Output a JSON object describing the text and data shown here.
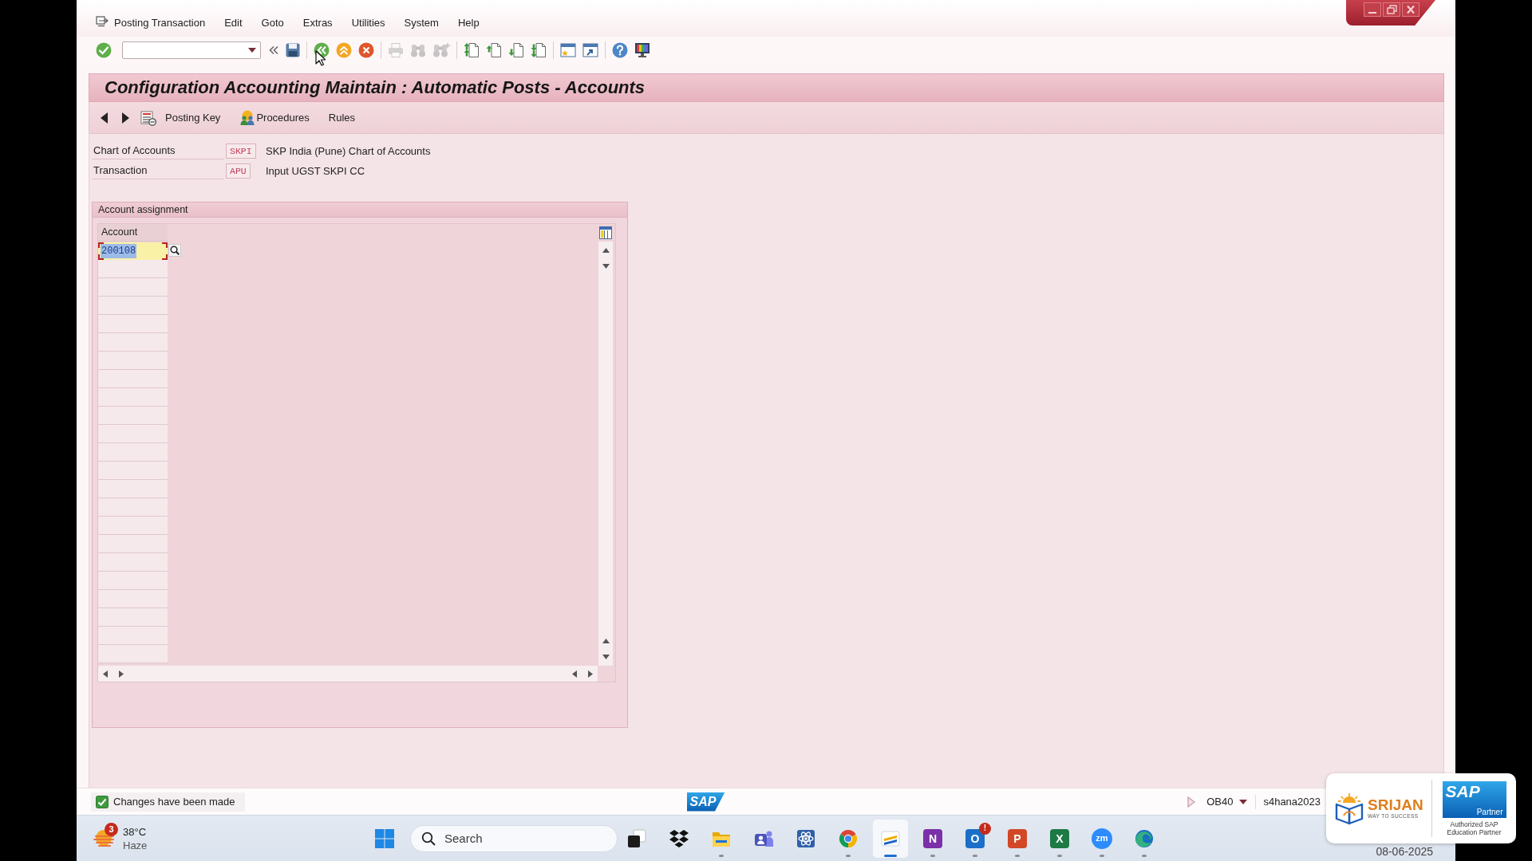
{
  "menu_bar": {
    "items": [
      {
        "label": "Posting Transaction"
      },
      {
        "label": "Edit"
      },
      {
        "label": "Goto"
      },
      {
        "label": "Extras"
      },
      {
        "label": "Utilities"
      },
      {
        "label": "System"
      },
      {
        "label": "Help"
      }
    ]
  },
  "toolbar": {
    "groups": [
      {
        "buttons": [
          {
            "kind": "enter",
            "disabled": false
          },
          {
            "kind": "command",
            "disabled": false
          },
          {
            "kind": "collapse",
            "disabled": false
          },
          {
            "kind": "save",
            "disabled": false
          }
        ]
      },
      {
        "buttons": [
          {
            "kind": "back",
            "disabled": false
          },
          {
            "kind": "exit",
            "disabled": false
          },
          {
            "kind": "cancel",
            "disabled": false
          }
        ]
      },
      {
        "buttons": [
          {
            "kind": "print",
            "disabled": true
          },
          {
            "kind": "find",
            "disabled": true
          },
          {
            "kind": "find_next",
            "disabled": true
          }
        ]
      },
      {
        "buttons": [
          {
            "kind": "first_page",
            "disabled": false
          },
          {
            "kind": "previous_page",
            "disabled": false
          },
          {
            "kind": "next_page",
            "disabled": false
          },
          {
            "kind": "last_page",
            "disabled": false
          }
        ]
      },
      {
        "buttons": [
          {
            "kind": "new_session",
            "disabled": false
          },
          {
            "kind": "shortcut",
            "disabled": false
          }
        ]
      },
      {
        "buttons": [
          {
            "kind": "help",
            "disabled": false
          },
          {
            "kind": "layout",
            "disabled": false
          }
        ]
      }
    ]
  },
  "title": "Configuration Accounting Maintain : Automatic Posts - Accounts",
  "app_toolbar": {
    "buttons": [
      {
        "kind": "previous"
      },
      {
        "kind": "next"
      },
      {
        "kind": "list",
        "label": "Posting Key"
      },
      {
        "kind": "people",
        "label": "Procedures"
      },
      {
        "kind": "text",
        "label": "Rules"
      }
    ]
  },
  "header_fields": [
    {
      "label": "Chart of Accounts",
      "value": "SKPI",
      "description": "SKP India (Pune) Chart of Accounts"
    },
    {
      "label": "Transaction",
      "value": "APU",
      "description": "Input UGST SKPI CC"
    }
  ],
  "account_assignment": {
    "title": "Account assignment",
    "column": "Account",
    "rows": [
      {
        "value": "200108",
        "focused": true
      }
    ]
  },
  "status_bar": {
    "message": {
      "kind": "success",
      "text": "Changes have been made"
    },
    "logo": "SAP",
    "transaction": "OB40",
    "system": "s4hana2023"
  },
  "taskbar": {
    "weather": {
      "badge": "3",
      "temperature": "38°C",
      "condition": "Haze"
    },
    "search": {
      "placeholder": "Search"
    },
    "apps": [
      {
        "kind": "squares",
        "running": false,
        "selected": false
      },
      {
        "kind": "diamonds",
        "running": false,
        "selected": false
      },
      {
        "kind": "folder",
        "running": true,
        "selected": false
      },
      {
        "kind": "people",
        "running": false,
        "selected": false
      },
      {
        "kind": "atom",
        "running": false,
        "selected": false
      },
      {
        "kind": "wheel",
        "running": true,
        "selected": false
      },
      {
        "kind": "stripes",
        "running": true,
        "selected": true
      },
      {
        "kind": "tile",
        "glyph": "N",
        "color": "#7b2fa8",
        "running": true,
        "selected": false
      },
      {
        "kind": "tile",
        "glyph": "O",
        "color": "#1a6fc9",
        "badge": "!",
        "running": true,
        "selected": false
      },
      {
        "kind": "tile",
        "glyph": "P",
        "color": "#d24726",
        "running": true,
        "selected": false
      },
      {
        "kind": "tile",
        "glyph": "X",
        "color": "#1d7a45",
        "running": true,
        "selected": false
      },
      {
        "kind": "disc",
        "glyph": "zm",
        "color": "#2d8cff",
        "running": true,
        "selected": false
      },
      {
        "kind": "swirl",
        "running": true,
        "selected": false
      }
    ],
    "date": "08-06-2025"
  },
  "partner_card": {
    "brand": "SRIJAN",
    "tagline": "WAY TO SUCCESS",
    "partner_logo": "SAP",
    "partner_badge": "Partner",
    "caption": "Authorized SAP Education Partner"
  }
}
